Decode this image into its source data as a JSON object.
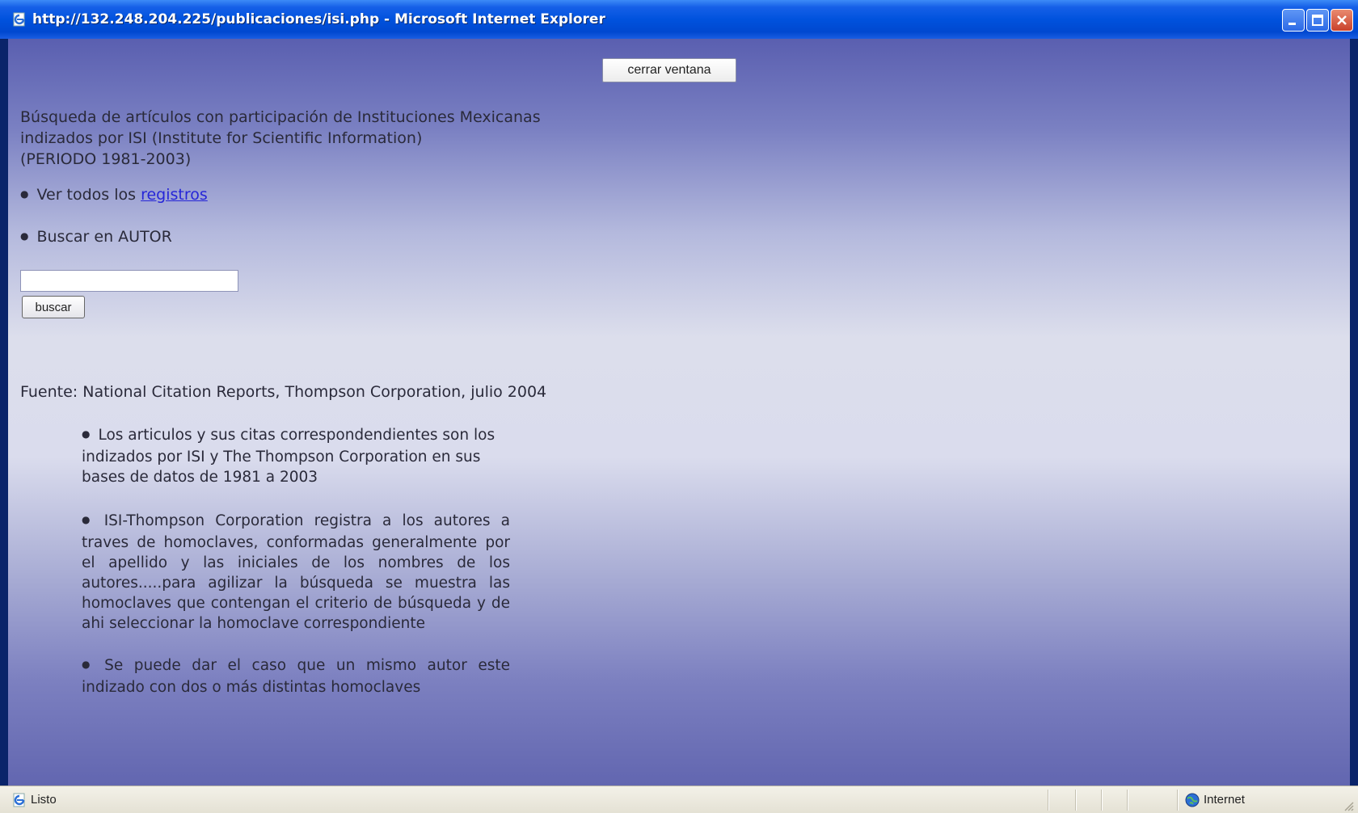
{
  "window": {
    "title": "http://132.248.204.225/publicaciones/isi.php - Microsoft Internet Explorer",
    "icons": {
      "app": "ie-page-icon",
      "minimize": "minimize-icon",
      "maximize": "maximize-icon",
      "close": "close-icon"
    }
  },
  "page": {
    "close_button": "cerrar ventana",
    "heading_lines": [
      "Búsqueda de artículos con participación de Instituciones Mexicanas",
      "indizados por ISI (Institute for Scientific Information)",
      "(PERIODO 1981-2003)"
    ],
    "ver_todos_prefix": "Ver todos los ",
    "ver_todos_link": "registros",
    "buscar_autor": "Buscar en AUTOR",
    "search": {
      "value": "",
      "placeholder": ""
    },
    "search_button": "buscar",
    "fuente": "Fuente: National Citation Reports, Thompson Corporation, julio 2004",
    "notes": [
      "Los articulos y sus citas correspondendientes son los indizados por ISI y The Thompson Corporation en sus bases de datos de 1981 a 2003",
      "ISI-Thompson Corporation registra a los autores a traves de homoclaves, conformadas generalmente por el apellido y las iniciales de los nombres de los autores.....para agilizar la búsqueda se muestra las homoclaves que contengan el criterio de búsqueda y de ahi seleccionar la homoclave correspondiente",
      "Se puede dar el caso que un mismo autor este indizado con dos o más distintas homoclaves"
    ]
  },
  "statusbar": {
    "status": "Listo",
    "zone": "Internet",
    "icons": {
      "status": "ie-page-icon",
      "zone": "globe-icon",
      "grip": "resize-grip-icon"
    }
  },
  "colors": {
    "link": "#2626d8",
    "titlebar": "#0052dd",
    "text": "#2a2a3a"
  }
}
